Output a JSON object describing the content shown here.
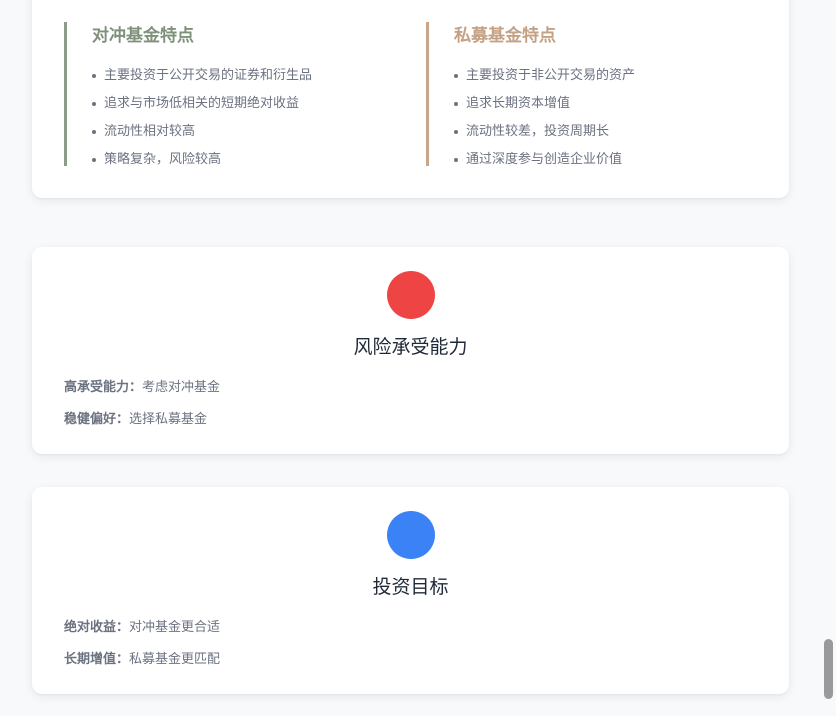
{
  "hedge_card": {
    "title": "对冲基金特点",
    "items": [
      "主要投资于公开交易的证券和衍生品",
      "追求与市场低相关的短期绝对收益",
      "流动性相对较高",
      "策略复杂，风险较高"
    ]
  },
  "pe_card": {
    "title": "私募基金特点",
    "items": [
      "主要投资于非公开交易的资产",
      "追求长期资本增值",
      "流动性较差，投资周期长",
      "通过深度参与创造企业价值"
    ]
  },
  "risk_card": {
    "title": "风险承受能力",
    "rows": [
      {
        "key": "高承受能力：",
        "value": "考虑对冲基金"
      },
      {
        "key": "稳健偏好：",
        "value": "选择私募基金"
      }
    ]
  },
  "goal_card": {
    "title": "投资目标",
    "rows": [
      {
        "key": "绝对收益：",
        "value": "对冲基金更合适"
      },
      {
        "key": "长期增值：",
        "value": "私募基金更匹配"
      }
    ]
  },
  "colors": {
    "hedge_accent": "#8c9c8a",
    "pe_accent": "#c7a68c",
    "risk_circle": "#ef4444",
    "goal_circle": "#3b82f6"
  }
}
